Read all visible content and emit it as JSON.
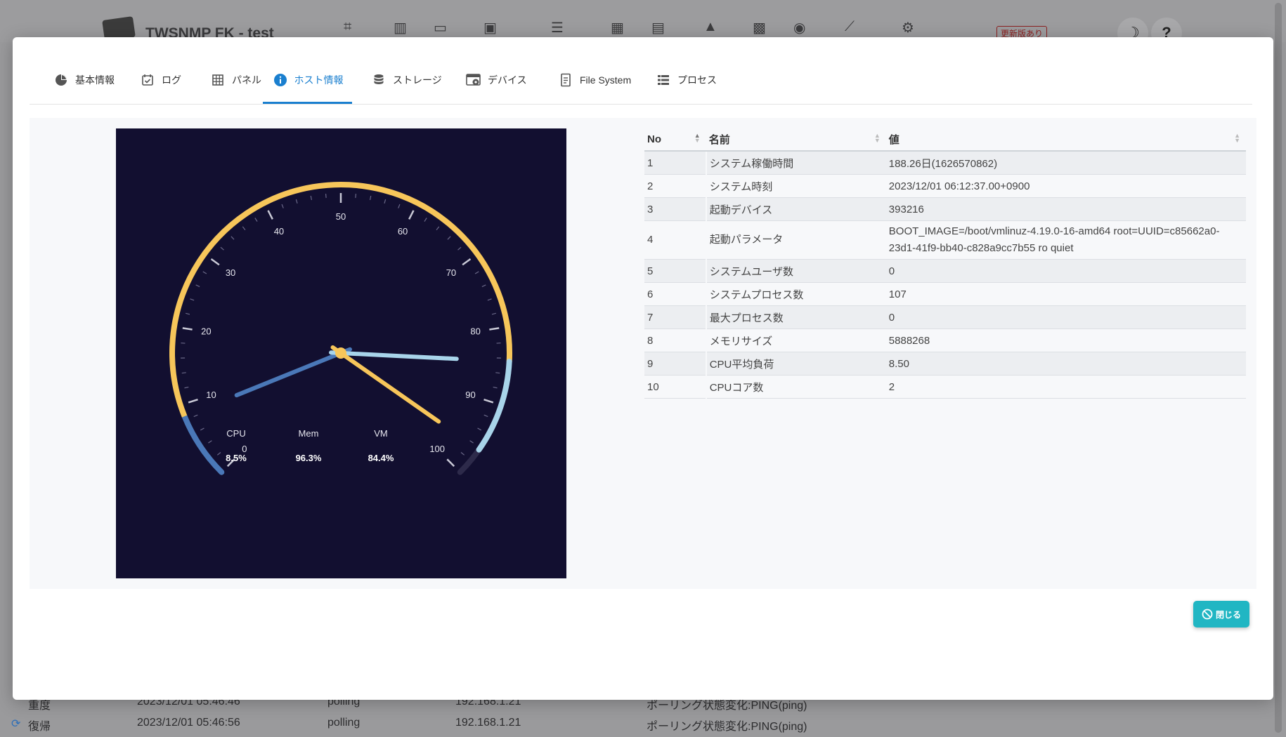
{
  "app": {
    "title": "TWSNMP FK - test",
    "update_badge": "更新版あり",
    "theme_icon": "☽",
    "help_icon": "?"
  },
  "background_rows": [
    {
      "state": "重度",
      "time": "2023/12/01 05:46:46",
      "type": "polling",
      "ip": "192.168.1.21",
      "msg": "ポーリング状態変化:PING(ping)"
    },
    {
      "state": "復帰",
      "time": "2023/12/01 05:46:56",
      "type": "polling",
      "ip": "192.168.1.21",
      "msg": "ポーリング状態変化:PING(ping)"
    }
  ],
  "tabs": [
    {
      "label": "基本情報",
      "icon": "pie-chart-icon"
    },
    {
      "label": "ログ",
      "icon": "calendar-check-icon"
    },
    {
      "label": "パネル",
      "icon": "grid-icon"
    },
    {
      "label": "ホスト情報",
      "icon": "info-icon",
      "active": true
    },
    {
      "label": "ストレージ",
      "icon": "database-icon"
    },
    {
      "label": "デバイス",
      "icon": "device-settings-icon"
    },
    {
      "label": "File System",
      "icon": "file-icon"
    },
    {
      "label": "プロセス",
      "icon": "list-icon"
    }
  ],
  "chart_data": {
    "type": "gauge",
    "scale": {
      "min": 0,
      "max": 100,
      "major_step": 10
    },
    "series": [
      {
        "name": "CPU",
        "value": 8.5,
        "display": "8.5%",
        "color": "#4a78b8"
      },
      {
        "name": "Mem",
        "value": 96.3,
        "display": "96.3%",
        "color": "#f7c65a"
      },
      {
        "name": "VM",
        "value": 84.4,
        "display": "84.4%",
        "color": "#a8d4ea"
      }
    ]
  },
  "table": {
    "headers": {
      "no": "No",
      "name": "名前",
      "value": "値"
    },
    "rows": [
      {
        "no": "1",
        "name": "システム稼働時間",
        "value": "188.26日(1626570862)"
      },
      {
        "no": "2",
        "name": "システム時刻",
        "value": "2023/12/01 06:12:37.00+0900"
      },
      {
        "no": "3",
        "name": "起動デバイス",
        "value": "393216"
      },
      {
        "no": "4",
        "name": "起動パラメータ",
        "value": "BOOT_IMAGE=/boot/vmlinuz-4.19.0-16-amd64 root=UUID=c85662a0-23d1-41f9-bb40-c828a9cc7b55 ro quiet"
      },
      {
        "no": "5",
        "name": "システムユーザ数",
        "value": "0"
      },
      {
        "no": "6",
        "name": "システムプロセス数",
        "value": "107"
      },
      {
        "no": "7",
        "name": "最大プロセス数",
        "value": "0"
      },
      {
        "no": "8",
        "name": "メモリサイズ",
        "value": "5888268"
      },
      {
        "no": "9",
        "name": "CPU平均負荷",
        "value": "8.50"
      },
      {
        "no": "10",
        "name": "CPUコア数",
        "value": "2"
      }
    ]
  },
  "close_button": {
    "label": "閉じる"
  },
  "colors": {
    "accent": "#1a7fcf",
    "close_button": "#21b6c3",
    "gauge_bg": "#120f30"
  }
}
